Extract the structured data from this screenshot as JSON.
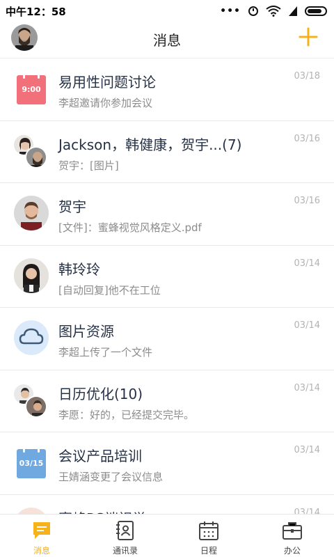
{
  "status_bar": {
    "time": "中午12：58"
  },
  "header": {
    "title": "消息"
  },
  "colors": {
    "accent": "#f5b21c",
    "calendar_red": "#f2707a",
    "calendar_blue": "#6fa9e0",
    "cloud_bg": "#dbeafa"
  },
  "messages": [
    {
      "title": "易用性问题讨论",
      "subtitle": "李超邀请你参加会议",
      "date": "03/18",
      "icon": "calendar-icon",
      "icon_text": "9:00"
    },
    {
      "title": "Jackson，韩健康，贺宇...(7)",
      "subtitle": "贺宇：[图片]",
      "date": "03/16",
      "icon": "group-avatar"
    },
    {
      "title": "贺宇",
      "subtitle": "[文件]：蜜蜂视觉风格定义.pdf",
      "date": "03/16",
      "icon": "avatar"
    },
    {
      "title": "韩玲玲",
      "subtitle": "[自动回复]他不在工位",
      "date": "03/14",
      "icon": "avatar"
    },
    {
      "title": "图片资源",
      "subtitle": "李超上传了一个文件",
      "date": "03/14",
      "icon": "cloud-icon"
    },
    {
      "title": "日历优化(10)",
      "subtitle": "李愿：好的，已经提交完毕。",
      "date": "03/14",
      "icon": "group-avatar"
    },
    {
      "title": "会议产品培训",
      "subtitle": "王婧涵变更了会议信息",
      "date": "03/14",
      "icon": "calendar-icon",
      "icon_text": "03/15"
    },
    {
      "title": "蜜蜂PC端视觉",
      "subtitle": "",
      "date": "03/14",
      "icon": "avatar"
    }
  ],
  "tabs": [
    {
      "label": "消息",
      "icon": "message-icon",
      "active": true
    },
    {
      "label": "通讯录",
      "icon": "contacts-icon",
      "active": false
    },
    {
      "label": "日程",
      "icon": "calendar-icon",
      "active": false
    },
    {
      "label": "办公",
      "icon": "briefcase-icon",
      "active": false
    }
  ]
}
